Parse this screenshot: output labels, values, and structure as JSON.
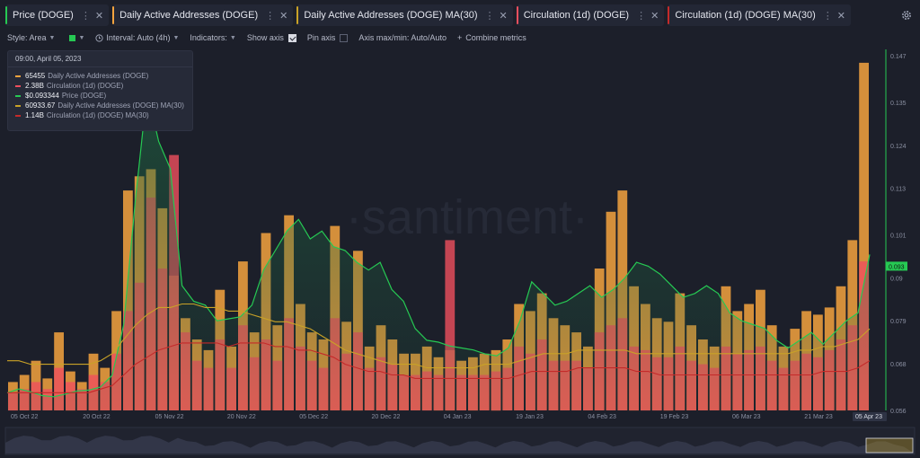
{
  "tabs": [
    {
      "label": "Price (DOGE)",
      "color": "#26c953"
    },
    {
      "label": "Daily Active Addresses (DOGE)",
      "color": "#f4a33e"
    },
    {
      "label": "Daily Active Addresses (DOGE) MA(30)",
      "color": "#c9a227"
    },
    {
      "label": "Circulation (1d) (DOGE)",
      "color": "#ef4f5e"
    },
    {
      "label": "Circulation (1d) (DOGE) MA(30)",
      "color": "#c42a2a"
    }
  ],
  "options": {
    "style": "Style: Area",
    "interval": "Interval: Auto (4h)",
    "indicators": "Indicators:",
    "show_axis": "Show axis",
    "pin_axis": "Pin axis",
    "axis_minmax": "Axis max/min: Auto/Auto",
    "combine": "Combine metrics",
    "plus": "+"
  },
  "tooltip": {
    "date": "09:00, April 05, 2023",
    "rows": [
      {
        "value": "65455",
        "label": "Daily Active Addresses (DOGE)",
        "color": "#f4a33e"
      },
      {
        "value": "2.38B",
        "label": "Circulation (1d) (DOGE)",
        "color": "#ef4f5e"
      },
      {
        "value": "$0.093344",
        "label": "Price (DOGE)",
        "color": "#26c953"
      },
      {
        "value": "60933.67",
        "label": "Daily Active Addresses (DOGE) MA(30)",
        "color": "#c9a227"
      },
      {
        "value": "1.14B",
        "label": "Circulation (1d) (DOGE) MA(30)",
        "color": "#c42a2a"
      }
    ]
  },
  "watermark": "·santiment·",
  "chart_data": {
    "type": "bar",
    "x_ticks": [
      "05 Oct 22",
      "20 Oct 22",
      "05 Nov 22",
      "20 Nov 22",
      "05 Dec 22",
      "20 Dec 22",
      "04 Jan 23",
      "19 Jan 23",
      "04 Feb 23",
      "19 Feb 23",
      "06 Mar 23",
      "21 Mar 23"
    ],
    "x_end_label": "05 Apr 23",
    "price_axis": {
      "ticks": [
        0.147,
        0.135,
        0.124,
        0.113,
        0.101,
        0.09,
        0.079,
        0.068,
        0.056
      ],
      "range": [
        0.056,
        0.147
      ],
      "current": "0.093",
      "current_color": "#26c953"
    },
    "series": [
      {
        "name": "Price (DOGE)",
        "kind": "area",
        "color": "#26c953",
        "values": [
          0.0605,
          0.0615,
          0.0608,
          0.0598,
          0.0595,
          0.0602,
          0.061,
          0.0612,
          0.062,
          0.065,
          0.078,
          0.11,
          0.138,
          0.125,
          0.118,
          0.088,
          0.084,
          0.083,
          0.079,
          0.0795,
          0.08,
          0.083,
          0.092,
          0.097,
          0.102,
          0.105,
          0.1,
          0.102,
          0.098,
          0.097,
          0.094,
          0.092,
          0.094,
          0.087,
          0.084,
          0.077,
          0.074,
          0.0735,
          0.0725,
          0.072,
          0.0715,
          0.0705,
          0.07,
          0.072,
          0.079,
          0.089,
          0.086,
          0.083,
          0.084,
          0.086,
          0.088,
          0.085,
          0.087,
          0.09,
          0.094,
          0.093,
          0.091,
          0.088,
          0.085,
          0.086,
          0.088,
          0.086,
          0.081,
          0.079,
          0.078,
          0.077,
          0.074,
          0.072,
          0.074,
          0.076,
          0.073,
          0.076,
          0.079,
          0.081,
          0.096
        ]
      },
      {
        "name": "Daily Active Addresses (DOGE)",
        "kind": "bar",
        "color": "#f4a33e",
        "values": [
          0.08,
          0.1,
          0.14,
          0.09,
          0.22,
          0.11,
          0.08,
          0.16,
          0.12,
          0.28,
          0.62,
          0.66,
          0.68,
          0.57,
          0.38,
          0.26,
          0.2,
          0.17,
          0.34,
          0.18,
          0.42,
          0.22,
          0.5,
          0.24,
          0.55,
          0.3,
          0.22,
          0.2,
          0.52,
          0.25,
          0.45,
          0.18,
          0.24,
          0.2,
          0.16,
          0.16,
          0.18,
          0.15,
          0.17,
          0.14,
          0.15,
          0.16,
          0.17,
          0.2,
          0.3,
          0.28,
          0.33,
          0.26,
          0.24,
          0.22,
          0.18,
          0.4,
          0.56,
          0.62,
          0.35,
          0.3,
          0.26,
          0.25,
          0.33,
          0.24,
          0.2,
          0.18,
          0.35,
          0.28,
          0.3,
          0.34,
          0.24,
          0.18,
          0.23,
          0.28,
          0.27,
          0.29,
          0.35,
          0.48,
          0.98
        ]
      },
      {
        "name": "Daily Active Addresses (DOGE) MA(30)",
        "kind": "line",
        "color": "#c9a227",
        "values": [
          0.14,
          0.14,
          0.13,
          0.13,
          0.13,
          0.13,
          0.13,
          0.13,
          0.14,
          0.16,
          0.2,
          0.24,
          0.27,
          0.29,
          0.29,
          0.3,
          0.3,
          0.29,
          0.29,
          0.28,
          0.28,
          0.27,
          0.26,
          0.25,
          0.25,
          0.24,
          0.23,
          0.21,
          0.19,
          0.17,
          0.16,
          0.15,
          0.14,
          0.13,
          0.13,
          0.13,
          0.12,
          0.12,
          0.12,
          0.12,
          0.12,
          0.13,
          0.13,
          0.13,
          0.14,
          0.15,
          0.16,
          0.16,
          0.16,
          0.17,
          0.17,
          0.17,
          0.17,
          0.17,
          0.16,
          0.16,
          0.16,
          0.16,
          0.16,
          0.16,
          0.16,
          0.16,
          0.16,
          0.16,
          0.16,
          0.16,
          0.16,
          0.16,
          0.17,
          0.17,
          0.18,
          0.18,
          0.19,
          0.2,
          0.23
        ]
      },
      {
        "name": "Circulation (1d) (DOGE)",
        "kind": "bar",
        "color": "#ef4f5e",
        "values": [
          0.05,
          0.06,
          0.08,
          0.06,
          0.12,
          0.08,
          0.06,
          0.1,
          0.08,
          0.16,
          0.28,
          0.36,
          0.6,
          0.4,
          0.72,
          0.22,
          0.14,
          0.12,
          0.2,
          0.12,
          0.24,
          0.15,
          0.2,
          0.14,
          0.26,
          0.18,
          0.14,
          0.12,
          0.26,
          0.16,
          0.22,
          0.12,
          0.15,
          0.13,
          0.1,
          0.1,
          0.11,
          0.1,
          0.48,
          0.1,
          0.1,
          0.1,
          0.11,
          0.12,
          0.18,
          0.16,
          0.2,
          0.14,
          0.14,
          0.14,
          0.12,
          0.22,
          0.24,
          0.26,
          0.18,
          0.17,
          0.15,
          0.15,
          0.18,
          0.14,
          0.13,
          0.12,
          0.18,
          0.16,
          0.17,
          0.18,
          0.14,
          0.12,
          0.14,
          0.16,
          0.15,
          0.17,
          0.2,
          0.24,
          0.42
        ]
      },
      {
        "name": "Circulation (1d) (DOGE) MA(30)",
        "kind": "line",
        "color": "#c42a2a",
        "values": [
          0.05,
          0.05,
          0.05,
          0.05,
          0.05,
          0.05,
          0.05,
          0.05,
          0.06,
          0.07,
          0.1,
          0.13,
          0.15,
          0.17,
          0.18,
          0.19,
          0.19,
          0.19,
          0.19,
          0.18,
          0.19,
          0.19,
          0.19,
          0.18,
          0.18,
          0.17,
          0.17,
          0.16,
          0.15,
          0.13,
          0.12,
          0.11,
          0.11,
          0.1,
          0.1,
          0.09,
          0.09,
          0.09,
          0.09,
          0.09,
          0.09,
          0.09,
          0.09,
          0.09,
          0.1,
          0.11,
          0.11,
          0.11,
          0.11,
          0.12,
          0.12,
          0.12,
          0.12,
          0.12,
          0.11,
          0.11,
          0.1,
          0.1,
          0.1,
          0.1,
          0.1,
          0.1,
          0.1,
          0.1,
          0.1,
          0.1,
          0.1,
          0.1,
          0.1,
          0.1,
          0.11,
          0.11,
          0.11,
          0.12,
          0.14
        ]
      }
    ],
    "grid": false,
    "legend": "top-left"
  }
}
